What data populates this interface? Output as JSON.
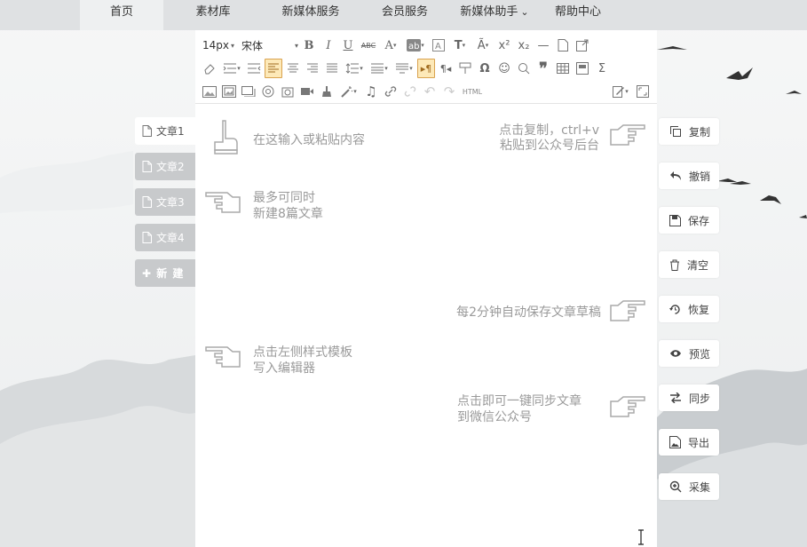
{
  "nav": {
    "items": [
      {
        "label": "首页",
        "active": true
      },
      {
        "label": "素材库"
      },
      {
        "label": "新媒体服务"
      },
      {
        "label": "会员服务"
      },
      {
        "label": "新媒体助手"
      },
      {
        "label": "帮助中心"
      }
    ],
    "dropdown_arrow": "⌄"
  },
  "articles": {
    "items": [
      "文章1",
      "文章2",
      "文章3",
      "文章4"
    ],
    "new_label": "✚ 新 建"
  },
  "toolbar": {
    "font_size": "14px",
    "font_family": "宋体",
    "html_label": "HTML"
  },
  "hints": {
    "input": "在这输入或粘贴内容",
    "copy_line1": "点击复制，ctrl+v",
    "copy_line2": "粘贴到公众号后台",
    "max_line1": "最多可同时",
    "max_line2": "新建8篇文章",
    "autosave": "每2分钟自动保存文章草稿",
    "template_line1": "点击左侧样式模板",
    "template_line2": "写入编辑器",
    "sync_line1": "点击即可一键同步文章",
    "sync_line2": "到微信公众号"
  },
  "side_actions": [
    "复制",
    "撤销",
    "保存",
    "清空",
    "恢复",
    "预览",
    "同步",
    "导出",
    "采集"
  ],
  "colors": {
    "nav_bg": "#dfe1e3",
    "tab_inactive": "#c8cacc",
    "align_selected": "#fde9b8"
  }
}
